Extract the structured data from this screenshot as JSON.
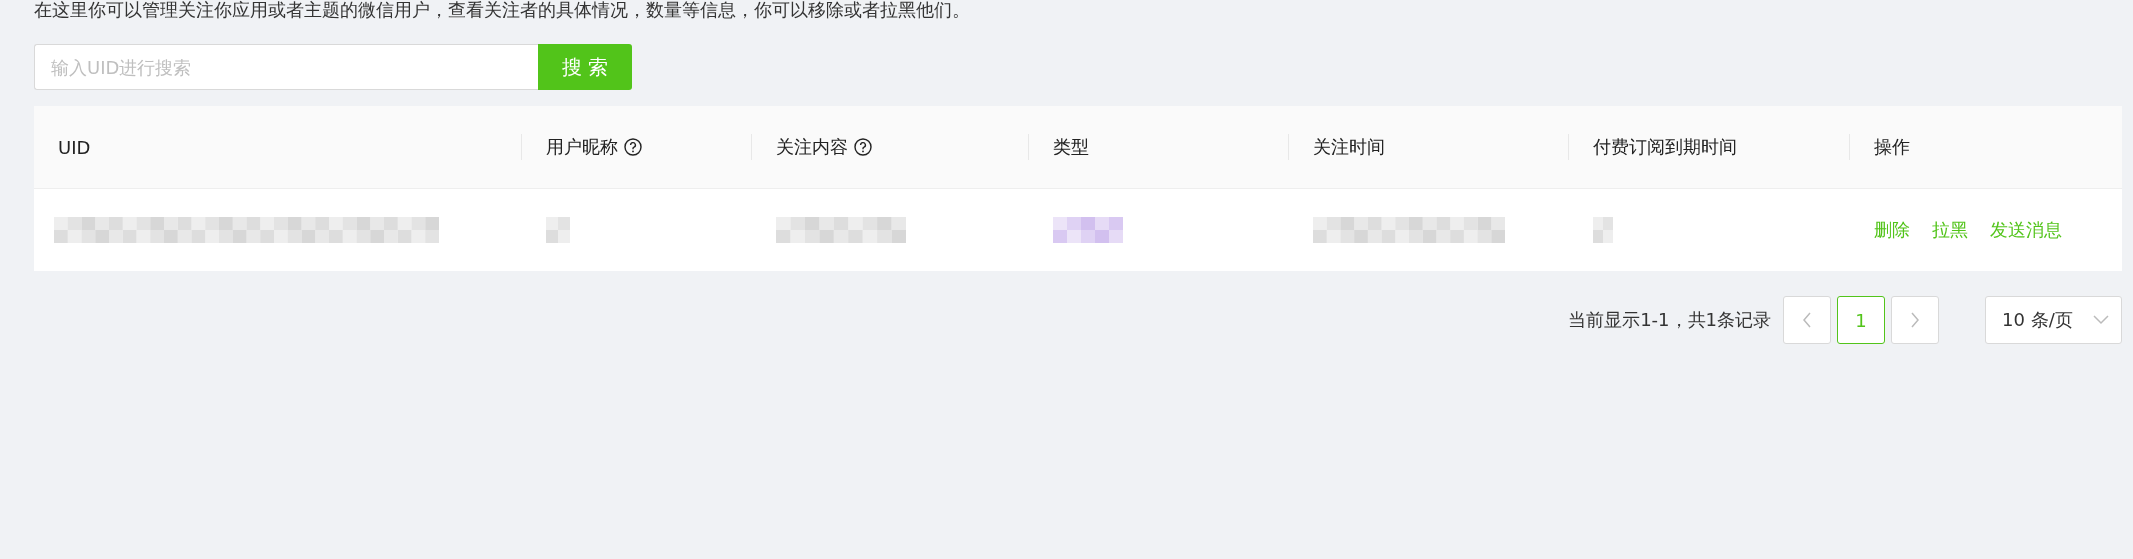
{
  "description": "在这里你可以管理关注你应用或者主题的微信用户，查看关注者的具体情况，数量等信息，你可以移除或者拉黑他们。",
  "search": {
    "placeholder": "输入UID进行搜索",
    "button": "搜 索"
  },
  "table": {
    "columns": [
      {
        "label": "UID",
        "help": false
      },
      {
        "label": "用户昵称",
        "help": true
      },
      {
        "label": "关注内容",
        "help": true
      },
      {
        "label": "类型",
        "help": false
      },
      {
        "label": "关注时间",
        "help": false
      },
      {
        "label": "付费订阅到期时间",
        "help": false
      },
      {
        "label": "操作",
        "help": false
      }
    ],
    "rows": [
      {
        "cells": [
          {
            "kind": "redacted"
          },
          {
            "kind": "redacted"
          },
          {
            "kind": "redacted"
          },
          {
            "kind": "redacted",
            "color": "#c9b3ec"
          },
          {
            "kind": "redacted"
          },
          {
            "kind": "redacted"
          },
          {
            "kind": "actions",
            "actions": [
              "删除",
              "拉黑",
              "发送消息"
            ]
          }
        ]
      }
    ]
  },
  "pagination": {
    "summary": "当前显示1-1，共1条记录",
    "pages": [
      {
        "label": "1",
        "selected": true
      }
    ],
    "page_size": "10 条/页"
  }
}
